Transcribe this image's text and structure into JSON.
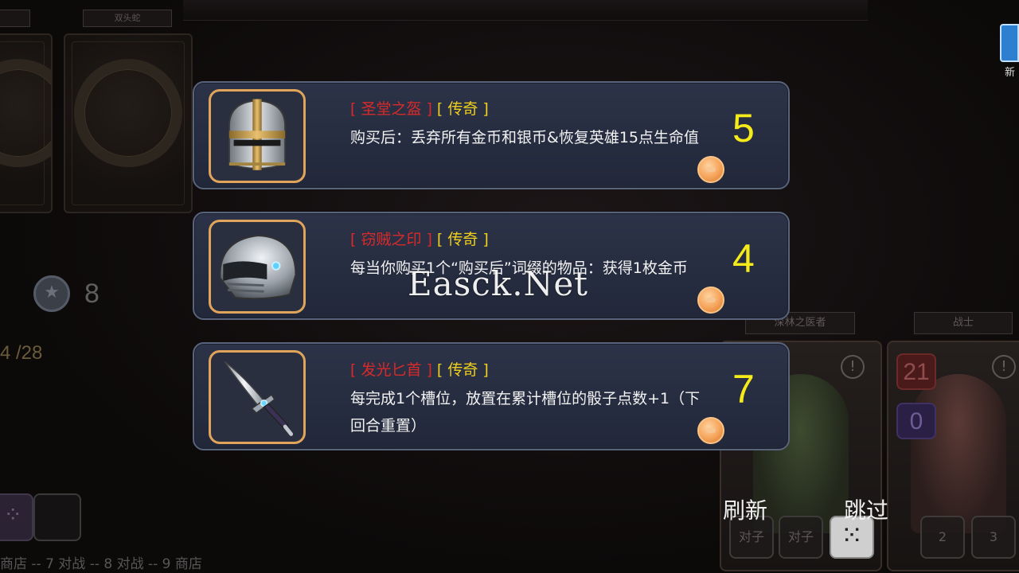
{
  "background": {
    "deck_labels": [
      "",
      "双头蛇"
    ],
    "coin_count": "8",
    "progress": "4 /28",
    "round_track": "商店 -- 7 对战 -- 8 对战 -- 9 商店",
    "heroes": [
      {
        "label": "深林之医者",
        "slots": [
          "对子",
          "对子"
        ],
        "has_dice": true
      },
      {
        "label": "战士",
        "hp": "21",
        "shield": "0",
        "slots": [
          "2",
          "3"
        ]
      }
    ],
    "side_label": "新"
  },
  "offers": [
    {
      "name": "[ 圣堂之盔 ]",
      "rarity": "[ 传奇 ]",
      "description": "购买后：丢弃所有金币和银币&恢复英雄15点生命值",
      "price": "5",
      "icon": "knight-helmet-icon"
    },
    {
      "name": "[ 窃贼之印 ]",
      "rarity": "[ 传奇 ]",
      "description": "每当你购买1个“购买后”词缀的物品：获得1枚金币",
      "price": "4",
      "icon": "steel-helmet-icon"
    },
    {
      "name": "[ 发光匕首 ]",
      "rarity": "[ 传奇 ]",
      "description": "每完成1个槽位，放置在累计槽位的骰子点数+1（下回合重置）",
      "price": "7",
      "icon": "dagger-icon"
    }
  ],
  "actions": {
    "refresh_label": "刷新",
    "skip_label": "跳过"
  },
  "watermark": "Easck.Net",
  "colors": {
    "name": "#d92a2a",
    "rarity": "#f1d11c",
    "price": "#f5ea1a",
    "frame": "#e0a45a"
  }
}
